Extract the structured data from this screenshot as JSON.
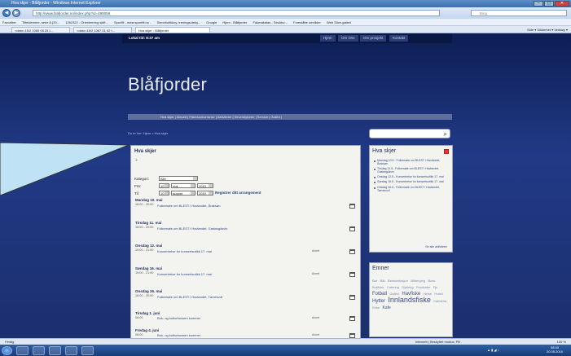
{
  "window": {
    "title": "Hva skjer - Blåfjorder - Windows Internet Explorer",
    "controls": [
      "–",
      "▢",
      "✕"
    ]
  },
  "addressbar": {
    "url": "http://www.blafjorder.no/index.php?id=490056",
    "search_placeholder": "Bing"
  },
  "favorites_bar": {
    "items": [
      "Favoritter",
      "Tilfeldemme, serie A (20...",
      "1262322 - Orienteering skift...",
      "Sportfil - www.sportfil.no -",
      "Sinnebutikkoy, treningsuteky...",
      "Google",
      "Hjem - Blåfjorder",
      "Fakmakatas - Struktur...",
      "Foreslåtte områder",
      "Web Slice-galleri"
    ]
  },
  "tabbar": {
    "tabs": [
      "<dato=15/2 1085 05 25 L...",
      "<dato=15/2 1087 01 02 t...",
      "Hva skjer - Blåfjorder"
    ],
    "commands": "Side ▾  Sikkerhet ▾  Verktøy ▾"
  },
  "site": {
    "local_time": "Lokal tid: 8:37 am",
    "top_nav": [
      "Hjem",
      "Om Oss",
      "Om prosjekt",
      "Kontakt"
    ],
    "logo": "Blåfjorder",
    "menu": "Hva skjer | Aktuelt | Fiskekonkurranse | Aktiviteter | Severdigheter | Service | Galleri |",
    "breadcrumb": "Du er her:  Hjem  »  Hva skjer",
    "main": {
      "heading": "Hva skjer",
      "add_icon": "+",
      "filter": {
        "category_label": "Kategori:",
        "category_value": "Alle",
        "from_label": "Fra:",
        "from_day": "10",
        "from_month": "mai",
        "from_year": "2010",
        "to_label": "Til:",
        "to_day": "10",
        "to_month": "august",
        "to_year": "2010",
        "register_link": "Registrer ditt arrangement"
      },
      "days": [
        {
          "date": "Mandag 10. mai",
          "events": [
            {
              "time": "18:00 - 20:00",
              "title": "Folkemøte om BLEST i Havlandet, Åraksøn",
              "tag": ""
            }
          ]
        },
        {
          "date": "Tirsdag 11. mai",
          "events": [
            {
              "time": "18:00 - 20:00",
              "title": "Folkemøte om BLEST i Havlandet, Grølangdsvin",
              "tag": ""
            }
          ]
        },
        {
          "date": "Onsdag 12. mai",
          "events": [
            {
              "time": "19:00 - 21:00",
              "title": "Konsertreise for konsertsutikk 17. mai",
              "tag": "Annet"
            }
          ]
        },
        {
          "date": "Søndag 16. mai",
          "events": [
            {
              "time": "19:00 - 21:00",
              "title": "Konsertreise for konsertsutikk 17. mai",
              "tag": "Annet"
            }
          ]
        },
        {
          "date": "Onsdag 26. mai",
          "events": [
            {
              "time": "18:00 - 20:00",
              "title": "Folkemøte om BLEST i Havlandet, Tørresvoll",
              "tag": ""
            }
          ]
        },
        {
          "date": "Tirsdag 1. juni",
          "events": [
            {
              "time": "08:00",
              "title": "Bok- og kulturbussen kommer",
              "tag": "Annet"
            }
          ]
        },
        {
          "date": "Fredag 4. juni",
          "events": [
            {
              "time": "08:00",
              "title": "Bok- og kulturbussen kommer",
              "tag": "Annet"
            }
          ]
        }
      ]
    },
    "sidebar": {
      "heading": "Hva skjer",
      "items": [
        "Mandag 10.5 - Folkemøte om BLEST i Havlandet, Åraksøn",
        "Tirsdag 11.5 - Folkemøte om BLEST i Havlandet, Grølangdsvin",
        "Onsdag 12.5 - Konsertreise for konsertsutikk 17. mai",
        "Søndag 16.5 - Konsertreise for konsertsutikk 17. mai",
        "Onsdag 26.5 - Folkemøte om BLEST i Havlandet, Tørresvoll"
      ],
      "more_link": "Se alle aktiviteter"
    },
    "tags": {
      "heading": "Emner",
      "cloud": [
        "Bar",
        "Båt",
        "Bensinstasjon",
        "Bilberging",
        "Buss",
        "Butikker",
        "Catering",
        "Dykking",
        "Festivaler",
        "Fjs",
        "Fotball",
        "Galleri",
        "Havfiske",
        "Helse",
        "Hotell",
        "Hytter",
        "Innlandsfiske",
        "Kafeteria",
        "Kirke",
        "Kafe"
      ]
    }
  },
  "statusbar": {
    "left": "Ferdig",
    "zone": "Internett | Beskyttet modus: På",
    "zoom": "100 %"
  },
  "taskbar": {
    "time": "08:40",
    "date": "20.05.2010"
  }
}
